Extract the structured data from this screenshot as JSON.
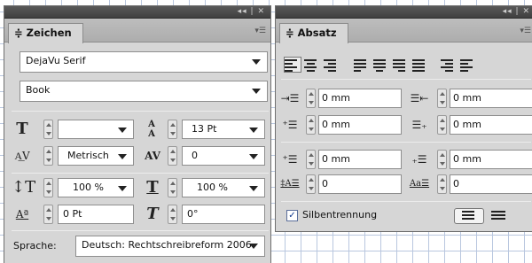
{
  "window_controls": "◂◂ | ✕",
  "zeichen": {
    "tab_label": "≑ Zeichen",
    "font_family": "DejaVu Serif",
    "font_style": "Book",
    "font_size": "",
    "leading": "13 Pt",
    "kerning": "Metrisch",
    "tracking": "0",
    "vertical_scale": "100 %",
    "horizontal_scale": "100 %",
    "baseline_shift": "0 Pt",
    "skew": "0°",
    "language_label": "Sprache:",
    "language_value": "Deutsch: Rechtschreibreform 2006"
  },
  "absatz": {
    "tab_label": "≑ Absatz",
    "left_indent": "0 mm",
    "right_indent": "0 mm",
    "first_line_indent": "0 mm",
    "last_line_indent": "0 mm",
    "space_before": "0 mm",
    "space_after": "0 mm",
    "dropcap_lines": "0",
    "dropcap_chars": "0",
    "hyphenation_label": "Silbentrennung",
    "hyphenation_checked": true
  },
  "icons": [
    "font-size-icon",
    "leading-icon",
    "kerning-icon",
    "tracking-icon",
    "vertical-scale-icon",
    "horizontal-scale-icon",
    "baseline-shift-icon",
    "skew-icon",
    "align-left-icon",
    "align-center-icon",
    "align-right-icon",
    "justify-left-icon",
    "justify-center-icon",
    "justify-right-icon",
    "justify-all-icon",
    "align-towards-spine-icon",
    "align-away-spine-icon",
    "left-indent-icon",
    "right-indent-icon",
    "first-line-indent-icon",
    "last-line-indent-icon",
    "space-before-icon",
    "space-after-icon",
    "dropcap-lines-icon",
    "dropcap-chars-icon",
    "baseline-grid-off-icon",
    "baseline-grid-on-icon"
  ]
}
